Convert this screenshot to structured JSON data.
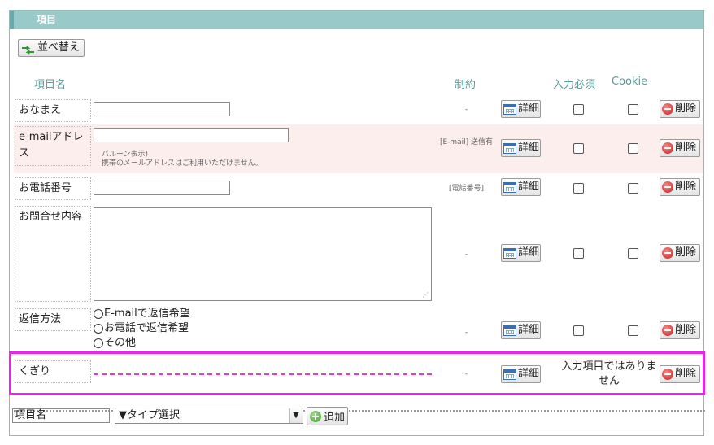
{
  "panel": {
    "title": "項目"
  },
  "toolbar": {
    "sort_label": "並べ替え"
  },
  "columns": {
    "name": "項目名",
    "constraint": "制約",
    "required": "入力必須",
    "cookie": "Cookie"
  },
  "buttons": {
    "detail": "詳細",
    "delete": "削除",
    "add": "追加"
  },
  "rows": [
    {
      "label": "おなまえ",
      "constraint": "-"
    },
    {
      "label": "e-mailアドレス",
      "constraint": "[E-mail] 送信有",
      "hint1": "バルーン表示)",
      "hint2": "携帯のメールアドレスはご利用いただけません。"
    },
    {
      "label": "お電話番号",
      "constraint": "[電話番号]"
    },
    {
      "label": "お問合せ内容",
      "constraint": "-"
    },
    {
      "label": "返信方法",
      "constraint": "-",
      "options": [
        "E-mailで返信希望",
        "お電話で返信希望",
        "その他"
      ]
    },
    {
      "label": "くぎり",
      "constraint": "-",
      "note": "入力項目ではありません"
    }
  ],
  "footer": {
    "name_value": "項目名",
    "type_select": "▼タイプ選択"
  },
  "colors": {
    "header": "#99c9c9",
    "accent_text": "#5b9b9b",
    "highlight": "#ee22ee",
    "pink_row": "#fdeeee"
  }
}
